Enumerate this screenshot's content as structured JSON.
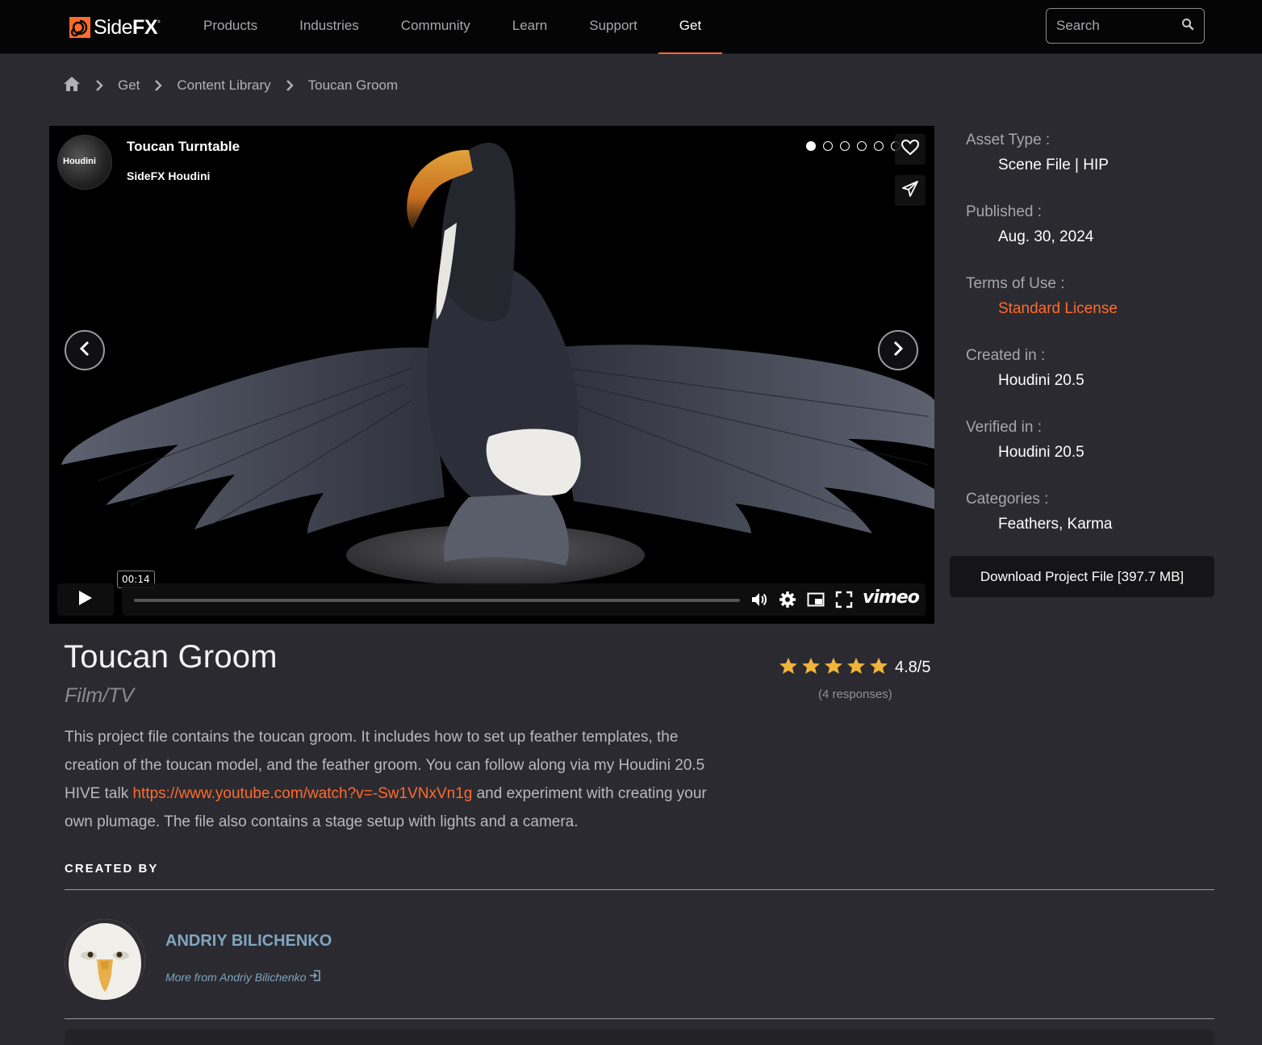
{
  "nav": {
    "brand": "SideFX",
    "items": [
      {
        "label": "Products"
      },
      {
        "label": "Industries"
      },
      {
        "label": "Community"
      },
      {
        "label": "Learn"
      },
      {
        "label": "Support"
      },
      {
        "label": "Get",
        "active": true
      }
    ],
    "search_placeholder": "Search"
  },
  "breadcrumb": {
    "items": [
      "Get",
      "Content Library",
      "Toucan Groom"
    ]
  },
  "video": {
    "title": "Toucan Turntable",
    "channel": "SideFX Houdini",
    "channel_avatar_text": "Houdini",
    "slide_count": 6,
    "active_slide": 1,
    "time_tooltip": "00:14",
    "player_brand": "vimeo"
  },
  "meta": {
    "rows": [
      {
        "label": "Asset Type :",
        "value": "Scene File | HIP"
      },
      {
        "label": "Published :",
        "value": "Aug. 30, 2024"
      },
      {
        "label": "Terms of Use :",
        "value": "Standard License",
        "is_link": true
      },
      {
        "label": "Created in :",
        "value": "Houdini 20.5"
      },
      {
        "label": "Verified in :",
        "value": "Houdini 20.5"
      },
      {
        "label": "Categories :",
        "value": "Feathers, Karma"
      }
    ],
    "download_label": "Download Project File [397.7 MB]"
  },
  "product": {
    "title": "Toucan Groom",
    "category": "Film/TV",
    "rating": 4.8,
    "rating_text": "4.8/5",
    "responses": "(4 responses)",
    "description_pre": "This project file contains the toucan groom. It includes how to set up feather templates, the creation of the toucan model, and the feather groom. You can follow along via my Houdini 20.5 HIVE talk ",
    "description_link": "https://www.youtube.com/watch?v=-Sw1VNxVn1g",
    "description_post": " and experiment with creating your own plumage. The file also contains a stage setup with lights and a camera."
  },
  "creator": {
    "heading": "CREATED BY",
    "name": "ANDRIY BILICHENKO",
    "more_link": "More from Andriy Bilichenko"
  },
  "colors": {
    "accent": "#ff6b2b",
    "background": "#2b2a30",
    "author": "#7fa6bf"
  }
}
